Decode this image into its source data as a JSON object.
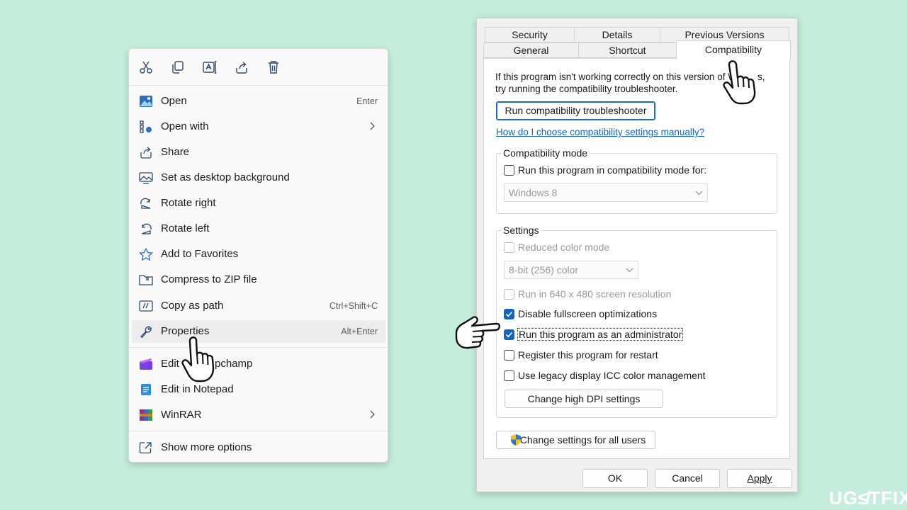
{
  "context_menu": {
    "toolbar": [
      {
        "icon": "cut-icon"
      },
      {
        "icon": "copy-icon"
      },
      {
        "icon": "rename-icon"
      },
      {
        "icon": "share-icon"
      },
      {
        "icon": "delete-icon"
      }
    ],
    "items": [
      {
        "label": "Open",
        "shortcut": "Enter",
        "icon": "photo-icon"
      },
      {
        "label": "Open with",
        "shortcut": "",
        "icon": "open-with-icon",
        "submenu": true
      },
      {
        "label": "Share",
        "shortcut": "",
        "icon": "share-icon"
      },
      {
        "label": "Set as desktop background",
        "shortcut": "",
        "icon": "desktop-background-icon"
      },
      {
        "label": "Rotate right",
        "shortcut": "",
        "icon": "rotate-right-icon"
      },
      {
        "label": "Rotate left",
        "shortcut": "",
        "icon": "rotate-left-icon"
      },
      {
        "label": "Add to Favorites",
        "shortcut": "",
        "icon": "star-icon"
      },
      {
        "label": "Compress to ZIP file",
        "shortcut": "",
        "icon": "zip-folder-icon"
      },
      {
        "label": "Copy as path",
        "shortcut": "Ctrl+Shift+C",
        "icon": "copy-path-icon"
      },
      {
        "label": "Properties",
        "shortcut": "Alt+Enter",
        "icon": "wrench-icon"
      },
      {
        "label": "Edit ",
        "shortcut": "",
        "icon": "clipchamp-icon"
      },
      {
        "label": "pchamp",
        "shortcut": "",
        "icon": ""
      },
      {
        "label": "Edit in Notepad",
        "shortcut": "",
        "icon": "notepad-icon"
      },
      {
        "label": "WinRAR",
        "shortcut": "",
        "icon": "winrar-icon",
        "submenu": true
      },
      {
        "label": "Show more options",
        "shortcut": "",
        "icon": "show-more-icon"
      }
    ]
  },
  "dialog": {
    "tabs_row1": [
      "Security",
      "Details",
      "Previous Versions"
    ],
    "tabs_row2": [
      "General",
      "Shortcut",
      "Compatibility"
    ],
    "active_tab": "Compatibility",
    "intro_line1": "If this program isn't working correctly on this version of W",
    "intro_line1_end": "s,",
    "intro_line2": "try running the compatibility troubleshooter.",
    "troubleshooter_button": "Run compatibility troubleshooter",
    "help_link": "How do I choose compatibility settings manually?",
    "compat_mode": {
      "title": "Compatibility mode",
      "checkbox_label": "Run this program in compatibility mode for:",
      "checked": false,
      "os_value": "Windows 8"
    },
    "settings": {
      "title": "Settings",
      "reduced_color": {
        "label": "Reduced color mode",
        "checked": false,
        "disabled": true
      },
      "color_value": "8-bit (256) color",
      "res_640": {
        "label": "Run in 640 x 480 screen resolution",
        "checked": false,
        "disabled": true
      },
      "fullscreen": {
        "label": "Disable fullscreen optimizations",
        "checked": true
      },
      "admin": {
        "label": "Run this program as an administrator",
        "checked": true
      },
      "restart": {
        "label": "Register this program for restart",
        "checked": false
      },
      "icc": {
        "label": "Use legacy display ICC color management",
        "checked": false
      },
      "dpi_button": "Change high DPI settings"
    },
    "all_users_button": "Change settings for all users",
    "ok": "OK",
    "cancel": "Cancel",
    "apply": "Apply"
  },
  "watermark": "UG≰TFIX",
  "colors": {
    "accent": "#1565c0",
    "background": "#c4eedb"
  }
}
